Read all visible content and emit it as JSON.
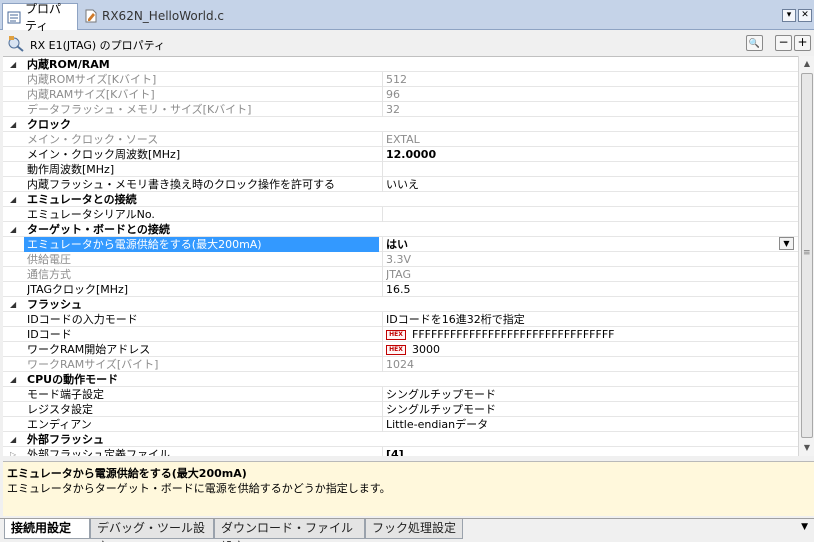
{
  "tabs": [
    {
      "label": "プロパティ",
      "icon": "properties-icon",
      "active": true
    },
    {
      "label": "RX62N_HelloWorld.c",
      "icon": "c-file-icon",
      "active": false
    }
  ],
  "window_buttons": {
    "dropdown": "▾",
    "close": "✕"
  },
  "header": {
    "title": "RX E1(JTAG) のプロパティ",
    "search_label": "🔍",
    "collapse_label": "−",
    "expand_label": "+"
  },
  "grid": {
    "categories": [
      {
        "name": "内蔵ROM/RAM"
      },
      {
        "name": "クロック"
      },
      {
        "name": "エミュレータとの接続"
      },
      {
        "name": "ターゲット・ボードとの接続"
      },
      {
        "name": "フラッシュ"
      },
      {
        "name": "CPUの動作モード"
      },
      {
        "name": "外部フラッシュ"
      }
    ],
    "rows": [
      {
        "name": "内蔵ROMサイズ[Kバイト]",
        "value": "512"
      },
      {
        "name": "内蔵RAMサイズ[Kバイト]",
        "value": "96"
      },
      {
        "name": "データフラッシュ・メモリ・サイズ[Kバイト]",
        "value": "32"
      },
      {
        "name": "メイン・クロック・ソース",
        "value": "EXTAL"
      },
      {
        "name": "メイン・クロック周波数[MHz]",
        "value": "12.0000"
      },
      {
        "name": "動作周波数[MHz]",
        "value": ""
      },
      {
        "name": "内蔵フラッシュ・メモリ書き換え時のクロック操作を許可する",
        "value": "いいえ"
      },
      {
        "name": "エミュレータシリアルNo.",
        "value": ""
      },
      {
        "name": "エミュレータから電源供給をする(最大200mA)",
        "value": "はい"
      },
      {
        "name": "供給電圧",
        "value": "3.3V"
      },
      {
        "name": "通信方式",
        "value": "JTAG"
      },
      {
        "name": "JTAGクロック[MHz]",
        "value": "16.5"
      },
      {
        "name": "IDコードの入力モード",
        "value": "IDコードを16進32桁で指定"
      },
      {
        "name": "IDコード",
        "value": "FFFFFFFFFFFFFFFFFFFFFFFFFFFFFFFF",
        "badge": "HEX"
      },
      {
        "name": "ワークRAM開始アドレス",
        "value": "3000",
        "badge": "HEX"
      },
      {
        "name": "ワークRAMサイズ[バイト]",
        "value": "1024"
      },
      {
        "name": "モード端子設定",
        "value": "シングルチップモード"
      },
      {
        "name": "レジスタ設定",
        "value": "シングルチップモード"
      },
      {
        "name": "エンディアン",
        "value": "Little-endianデータ"
      },
      {
        "name": "外部フラッシュ定義ファイル",
        "value": "[4]"
      }
    ]
  },
  "description": {
    "title": "エミュレータから電源供給をする(最大200mA)",
    "text": "エミュレータからターゲット・ボードに電源を供給するかどうか指定します。"
  },
  "bottom_tabs": [
    {
      "label": "接続用設定",
      "active": true
    },
    {
      "label": "デバッグ・ツール設定",
      "active": false
    },
    {
      "label": "ダウンロード・ファイル設定",
      "active": false
    },
    {
      "label": "フック処理設定",
      "active": false
    }
  ]
}
